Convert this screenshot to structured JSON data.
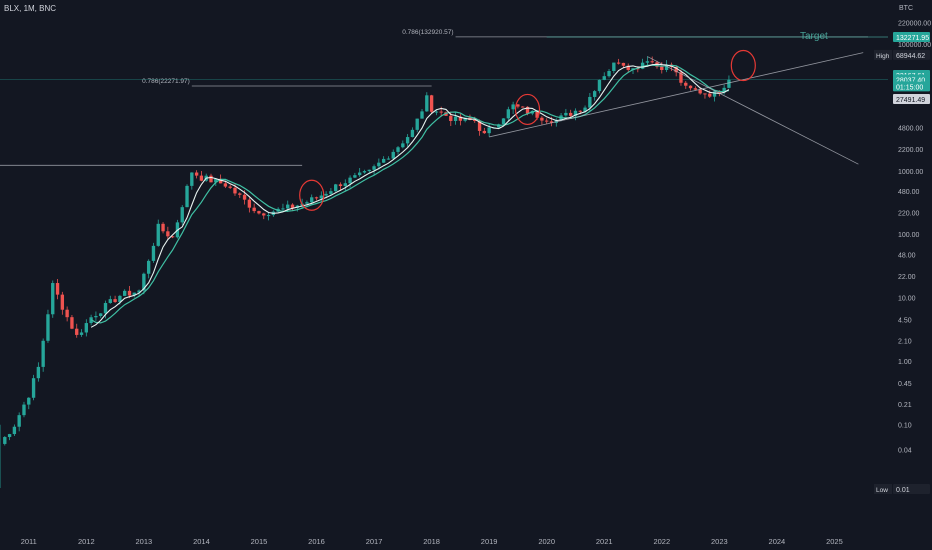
{
  "header": {
    "symbol_line": "BLX, 1M, BNC",
    "currency": "BTC"
  },
  "colors": {
    "background": "#131722",
    "up": "#26a69a",
    "down": "#ef5350",
    "ma_fast": "#e8f3f0",
    "ma_slow": "#3fbfa3",
    "fib_line": "#b2b5be",
    "target_line": "#4fb6a8",
    "circle": "#e53935",
    "text": "#b2b5be"
  },
  "chart_data": {
    "type": "candlestick",
    "y_scale": "log",
    "ylim": [
      0.02,
      300000
    ],
    "x_range": [
      "2010-07",
      "2025-08"
    ],
    "x_ticks": [
      "2011",
      "2012",
      "2013",
      "2014",
      "2015",
      "2016",
      "2017",
      "2018",
      "2019",
      "2020",
      "2021",
      "2022",
      "2023",
      "2024",
      "2025"
    ],
    "y_ticks": [
      "220000.00",
      "100000.00",
      "4800.00",
      "2200.00",
      "1000.00",
      "480.00",
      "220.00",
      "100.00",
      "48.00",
      "22.00",
      "10.00",
      "4.50",
      "2.10",
      "1.00",
      "0.45",
      "0.21",
      "0.10",
      "0.04"
    ],
    "price_tags": [
      {
        "label": "",
        "text": "132271.95",
        "value": 132271.95,
        "style": "target"
      },
      {
        "label": "High",
        "text": "68944.62",
        "value": 68944.62,
        "style": "high"
      },
      {
        "label": "",
        "text": "33167.61",
        "value": 33167.61,
        "style": "green"
      },
      {
        "label": "",
        "text": "28037.40",
        "value": 28037.4,
        "style": "green"
      },
      {
        "label": "",
        "text": "01:15:00",
        "value": 22000,
        "style": "green"
      },
      {
        "label": "",
        "text": "27491.49",
        "value": 16500,
        "style": "white"
      },
      {
        "label": "Low",
        "text": "0.01",
        "value": 0.0002,
        "style": "low"
      }
    ],
    "fib_levels": [
      {
        "label": "0.786(1247.98)",
        "value": 1247.98,
        "from": "2010-06",
        "to": "2015-10"
      },
      {
        "label": "0.786(22271.97)",
        "value": 22271.97,
        "from": "2013-11",
        "to": "2018-01"
      },
      {
        "label": "0.786(132920.57)",
        "value": 132920.57,
        "from": "2018-06",
        "to": "2025-08"
      }
    ],
    "target": {
      "label": "Target",
      "value": 132271.95
    },
    "anchors": [
      [
        "2010-07",
        0.05
      ],
      [
        "2010-10",
        0.1
      ],
      [
        "2011-01",
        0.3
      ],
      [
        "2011-03",
        0.8
      ],
      [
        "2011-06",
        16
      ],
      [
        "2011-09",
        5
      ],
      [
        "2011-11",
        2.5
      ],
      [
        "2012-02",
        5
      ],
      [
        "2012-08",
        11
      ],
      [
        "2012-12",
        13
      ],
      [
        "2013-04",
        130
      ],
      [
        "2013-07",
        90
      ],
      [
        "2013-11",
        1000
      ],
      [
        "2014-01",
        800
      ],
      [
        "2014-06",
        620
      ],
      [
        "2015-01",
        220
      ],
      [
        "2015-06",
        250
      ],
      [
        "2015-10",
        310
      ],
      [
        "2016-01",
        380
      ],
      [
        "2016-06",
        650
      ],
      [
        "2016-12",
        960
      ],
      [
        "2017-06",
        2500
      ],
      [
        "2017-09",
        4300
      ],
      [
        "2017-12",
        14000
      ],
      [
        "2018-01",
        10000
      ],
      [
        "2018-06",
        6400
      ],
      [
        "2018-10",
        6300
      ],
      [
        "2018-12",
        3700
      ],
      [
        "2019-06",
        10800
      ],
      [
        "2019-12",
        7200
      ],
      [
        "2020-03",
        6400
      ],
      [
        "2020-09",
        10800
      ],
      [
        "2020-12",
        29000
      ],
      [
        "2021-04",
        57000
      ],
      [
        "2021-07",
        41000
      ],
      [
        "2021-10",
        61000
      ],
      [
        "2021-12",
        46000
      ],
      [
        "2022-03",
        45000
      ],
      [
        "2022-06",
        20000
      ],
      [
        "2022-11",
        17000
      ],
      [
        "2022-12",
        16500
      ],
      [
        "2023-03",
        28000
      ]
    ],
    "trendlines": [
      {
        "from": [
          "2019-01",
          3500
        ],
        "to": [
          "2025-07",
          75000
        ]
      },
      {
        "from": [
          "2021-10",
          65000
        ],
        "to": [
          "2025-06",
          1300
        ]
      }
    ],
    "circles": [
      {
        "center": [
          "2015-12",
          420
        ]
      },
      {
        "center": [
          "2019-09",
          9500
        ]
      },
      {
        "center": [
          "2023-06",
          47000
        ]
      }
    ]
  }
}
